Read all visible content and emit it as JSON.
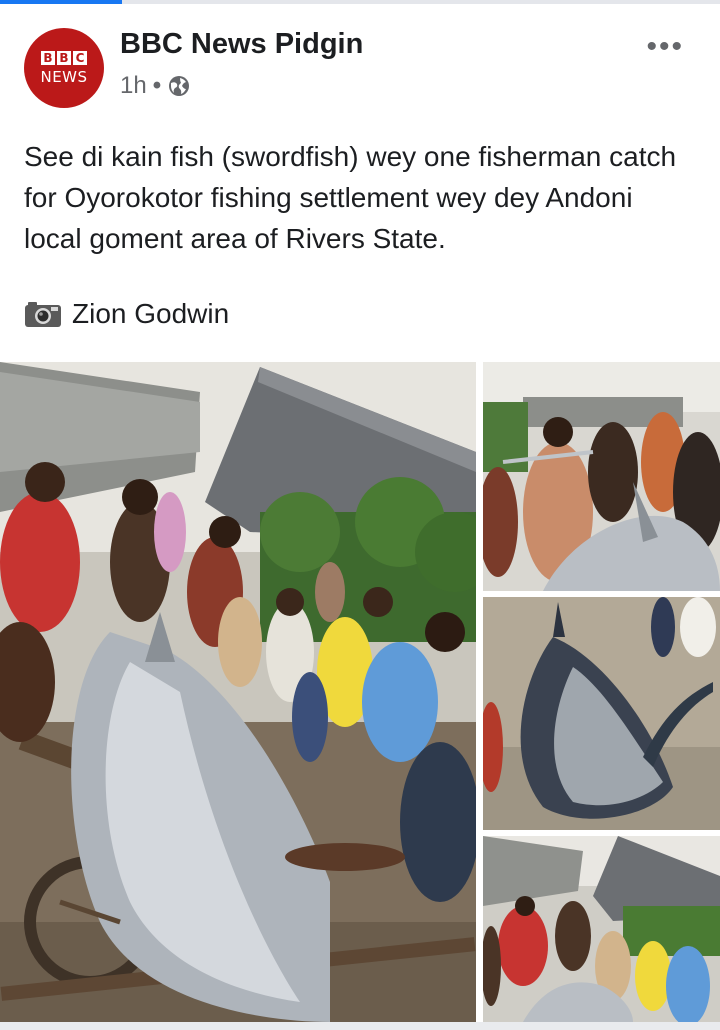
{
  "progress": {
    "fraction": 0.17,
    "color": "#1877f2"
  },
  "post": {
    "page_name": "BBC News Pidgin",
    "avatar_letters": [
      "B",
      "B",
      "C"
    ],
    "avatar_word": "NEWS",
    "avatar_color": "#bb1919",
    "time": "1h",
    "separator": "•",
    "privacy_icon": "globe-icon",
    "more_label": "•••",
    "text": "See di kain fish (swordfish) wey one fisherman catch for Oyorokotor fishing settlement wey dey Andoni local goment area of Rivers State.",
    "credit_icon": "camera-icon",
    "credit_name": "Zion Godwin"
  },
  "photos": [
    {
      "name": "photo-main",
      "subject": "swordfish on wooden cart surrounded by crowd"
    },
    {
      "name": "photo-1",
      "subject": "man holding swordfish bill in crowd"
    },
    {
      "name": "photo-2",
      "subject": "swordfish lying on wet sand"
    },
    {
      "name": "photo-3",
      "subject": "crowd around swordfish near buildings"
    }
  ]
}
